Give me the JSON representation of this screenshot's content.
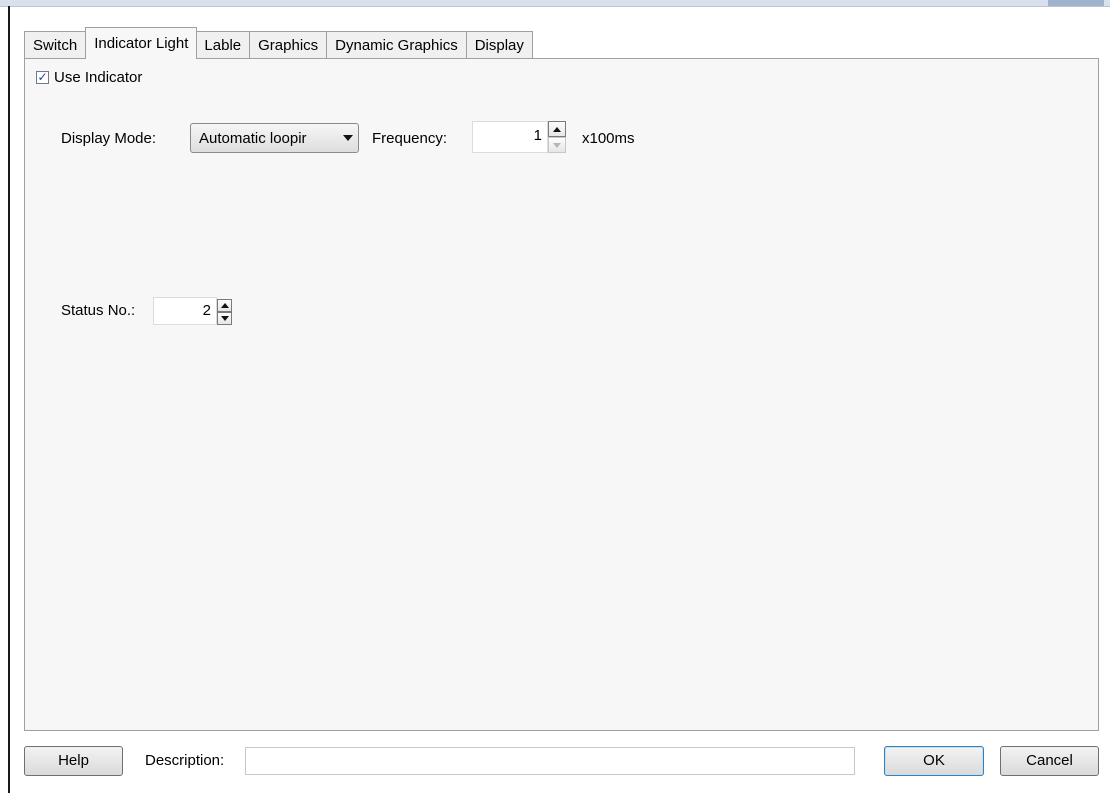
{
  "tabs": [
    {
      "label": "Switch",
      "active": false
    },
    {
      "label": "Indicator Light",
      "active": true
    },
    {
      "label": "Lable",
      "active": false
    },
    {
      "label": "Graphics",
      "active": false
    },
    {
      "label": "Dynamic Graphics",
      "active": false
    },
    {
      "label": "Display",
      "active": false
    }
  ],
  "indicator": {
    "use_indicator_label": "Use Indicator",
    "use_indicator_checked": true,
    "display_mode_label": "Display Mode:",
    "display_mode_value": "Automatic loopir",
    "frequency_label": "Frequency:",
    "frequency_value": "1",
    "frequency_unit": "x100ms",
    "status_no_label": "Status No.:",
    "status_no_value": "2"
  },
  "footer": {
    "help_label": "Help",
    "description_label": "Description:",
    "description_value": "",
    "ok_label": "OK",
    "cancel_label": "Cancel"
  },
  "icons": {
    "combo_arrow": "chevron-down-icon",
    "spin_up": "arrow-up-icon",
    "spin_down": "arrow-down-icon",
    "check": "checkmark-icon"
  },
  "colors": {
    "panel_bg": "#f7f7f7",
    "tab_border": "#a0a0a0",
    "check_mark": "#1f3fa6",
    "ok_border": "#3c7fb1"
  }
}
